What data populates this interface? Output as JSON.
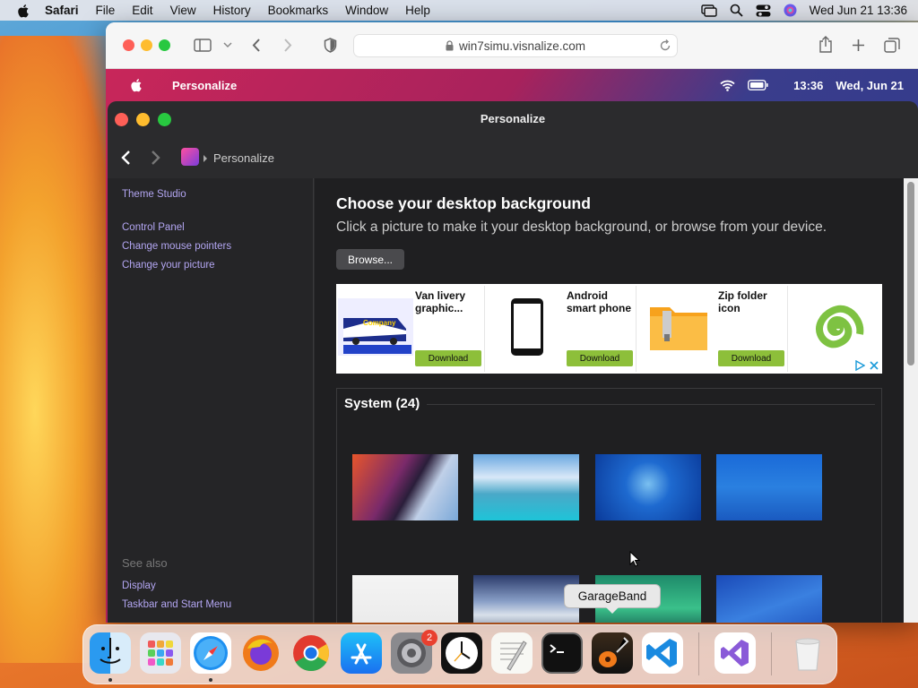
{
  "menubar": {
    "app_name": "Safari",
    "items": [
      "File",
      "Edit",
      "View",
      "History",
      "Bookmarks",
      "Window",
      "Help"
    ],
    "clock": "Wed Jun 21  13:36"
  },
  "safari": {
    "url": "win7simu.visnalize.com"
  },
  "web_menubar": {
    "title": "Personalize",
    "time": "13:36",
    "date": "Wed, Jun 21"
  },
  "personalize": {
    "window_title": "Personalize",
    "breadcrumb": "Personalize",
    "sidebar": {
      "links": [
        "Theme Studio",
        "Control Panel",
        "Change mouse pointers",
        "Change your picture"
      ],
      "see_also_label": "See also",
      "see_also_links": [
        "Display",
        "Taskbar and Start Menu"
      ]
    },
    "heading": "Choose your desktop background",
    "subheading": "Click a picture to make it your desktop background, or browse from your device.",
    "browse_label": "Browse...",
    "ads": [
      {
        "title": "Van livery graphic...",
        "button": "Download"
      },
      {
        "title": "Android smart phone",
        "button": "Download"
      },
      {
        "title": "Zip folder icon",
        "button": "Download"
      }
    ],
    "system_group": "System (24)"
  },
  "tooltip": "GarageBand",
  "dock": {
    "apps": [
      "finder",
      "launchpad",
      "safari",
      "firefox",
      "chrome",
      "app-store",
      "system-settings",
      "clock",
      "textedit",
      "terminal",
      "garageband",
      "vscode",
      "visual-studio",
      "trash"
    ],
    "settings_badge": "2"
  }
}
